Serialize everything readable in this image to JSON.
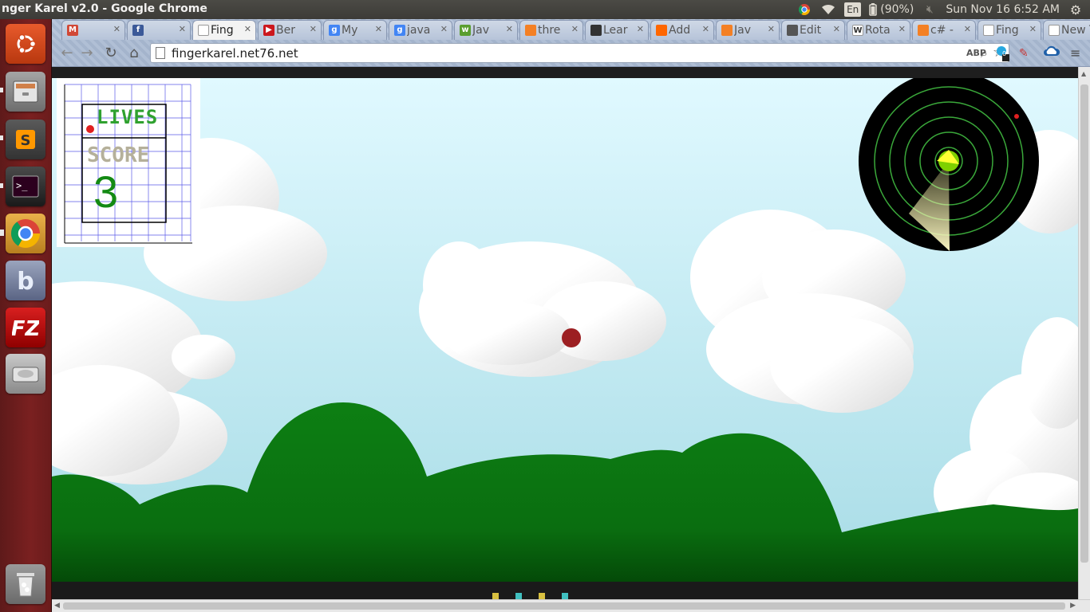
{
  "panel": {
    "window_title": "nger Karel v2.0 - Google Chrome",
    "battery": "(90%)",
    "keyboard_lang": "En",
    "datetime": "Sun Nov 16  6:52 AM"
  },
  "launcher": {
    "items": [
      {
        "name": "ubuntu-dash-icon",
        "color": "#dd4814"
      },
      {
        "name": "files-icon",
        "color": "#8c8c8c"
      },
      {
        "name": "sublime-text-icon",
        "color": "#4a4a4a"
      },
      {
        "name": "terminal-icon",
        "color": "#2b2b2b"
      },
      {
        "name": "chrome-icon",
        "color": "#d9a03a"
      },
      {
        "name": "bluegriffon-icon",
        "color": "#6a7a9a"
      },
      {
        "name": "filezilla-icon",
        "color": "#bf0000"
      },
      {
        "name": "disk-icon",
        "color": "#9a9a9a"
      },
      {
        "name": "trash-icon",
        "color": "#8a8a8a"
      }
    ]
  },
  "tabs": [
    {
      "label": "",
      "fav": "M",
      "favcolor": "#d14836",
      "active": false
    },
    {
      "label": "",
      "fav": "f",
      "favcolor": "#3b5998",
      "active": false
    },
    {
      "label": "Fing",
      "fav": "",
      "favcolor": "#ffffff",
      "active": true
    },
    {
      "label": "Ber",
      "fav": "▶",
      "favcolor": "#cc181e",
      "active": false
    },
    {
      "label": "My",
      "fav": "g",
      "favcolor": "#4285f4",
      "active": false
    },
    {
      "label": "java",
      "fav": "g",
      "favcolor": "#4285f4",
      "active": false
    },
    {
      "label": "Jav",
      "fav": "w",
      "favcolor": "#5a9e2f",
      "active": false
    },
    {
      "label": "thre",
      "fav": "",
      "favcolor": "#f48024",
      "active": false
    },
    {
      "label": "Lear",
      "fav": "",
      "favcolor": "#333333",
      "active": false
    },
    {
      "label": "Add",
      "fav": "",
      "favcolor": "#ff6600",
      "active": false
    },
    {
      "label": "Jav",
      "fav": "",
      "favcolor": "#f48024",
      "active": false
    },
    {
      "label": "Edit",
      "fav": "",
      "favcolor": "#555555",
      "active": false
    },
    {
      "label": "Rota",
      "fav": "W",
      "favcolor": "#ffffff",
      "active": false
    },
    {
      "label": "c# -",
      "fav": "",
      "favcolor": "#f48024",
      "active": false
    },
    {
      "label": "Fing",
      "fav": "",
      "favcolor": "#ffffff",
      "active": false
    },
    {
      "label": "New T",
      "fav": "",
      "favcolor": "#ffffff",
      "active": false
    }
  ],
  "omnibox": {
    "url": "fingerkarel.net76.net"
  },
  "extensions": {
    "abp": "ABP",
    "badge": "0"
  },
  "game": {
    "lives_label": "LIVES",
    "score_label": "SCORE",
    "score": "3",
    "lives": 1,
    "colors": {
      "sky_top": "#e0f9ff",
      "sky_bottom": "#a8dce6",
      "hill": "#0d7a12",
      "cloud": "#ffffff",
      "ball": "#9c1f22",
      "radar": "#000000",
      "radar_ring": "#3aa83a"
    }
  }
}
